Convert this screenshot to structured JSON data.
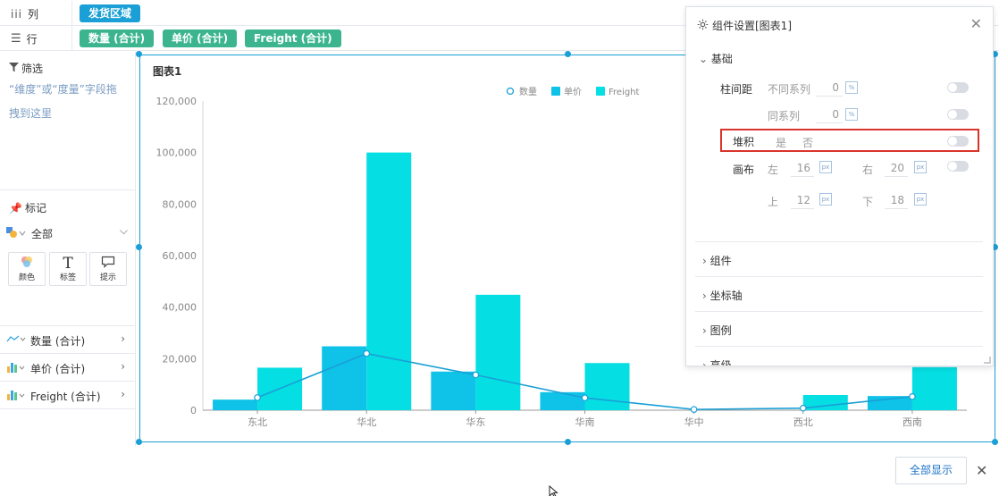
{
  "shelves": {
    "columns": {
      "label": "列",
      "pills": [
        "发货区域"
      ]
    },
    "rows": {
      "label": "行",
      "pills": [
        "数量 (合计)",
        "单价 (合计)",
        "Freight (合计)"
      ]
    }
  },
  "left_panel": {
    "filter_title": "筛选",
    "filter_hint": "“维度”或“度量”字段拖拽到这里",
    "marks_title": "标记",
    "marks_select": "全部",
    "mark_buttons": [
      "颜色",
      "标签",
      "提示"
    ],
    "fields": [
      {
        "label": "数量 (合计)",
        "icon": "line-chart-icon"
      },
      {
        "label": "单价 (合计)",
        "icon": "bar-chart-icon"
      },
      {
        "label": "Freight (合计)",
        "icon": "bar-chart-icon"
      }
    ]
  },
  "chart_title": "图表1",
  "chart_data": {
    "type": "bar",
    "categories": [
      "东北",
      "华北",
      "华东",
      "华南",
      "华中",
      "西北",
      "西南"
    ],
    "series": [
      {
        "name": "数量",
        "type": "line",
        "values": [
          4900,
          22000,
          13700,
          4800,
          300,
          800,
          5300
        ],
        "color": "#1a9fd6"
      },
      {
        "name": "单价",
        "type": "bar",
        "values": [
          4100,
          24800,
          15000,
          7000,
          0,
          0,
          5500
        ],
        "color": "#0ec2e8"
      },
      {
        "name": "Freight",
        "type": "bar",
        "values": [
          16500,
          100000,
          44800,
          18300,
          0,
          5900,
          16700
        ],
        "color": "#05dee3"
      }
    ],
    "yticks": [
      "0",
      "20,000",
      "40,000",
      "60,000",
      "80,000",
      "100,000",
      "120,000"
    ],
    "ylim": [
      0,
      120000
    ],
    "legend_position": "top-center",
    "grid": false
  },
  "settings_panel": {
    "title": "组件设置[图表1]",
    "section_basic": "基础",
    "bar_spacing_label": "柱间距",
    "diff_series_label": "不同系列",
    "diff_series_value": "0",
    "same_series_label": "同系列",
    "same_series_value": "0",
    "stack_label": "堆积",
    "stack_yes": "是",
    "stack_no": "否",
    "canvas_label": "画布",
    "left_label": "左",
    "left_value": "16",
    "right_label": "右",
    "right_value": "20",
    "top_label": "上",
    "top_value": "12",
    "bottom_label": "下",
    "bottom_value": "18",
    "unit_percent": "%",
    "unit_px": "px",
    "groups": [
      "组件",
      "坐标轴",
      "图例",
      "高级"
    ]
  },
  "show_all_button": "全部显示"
}
